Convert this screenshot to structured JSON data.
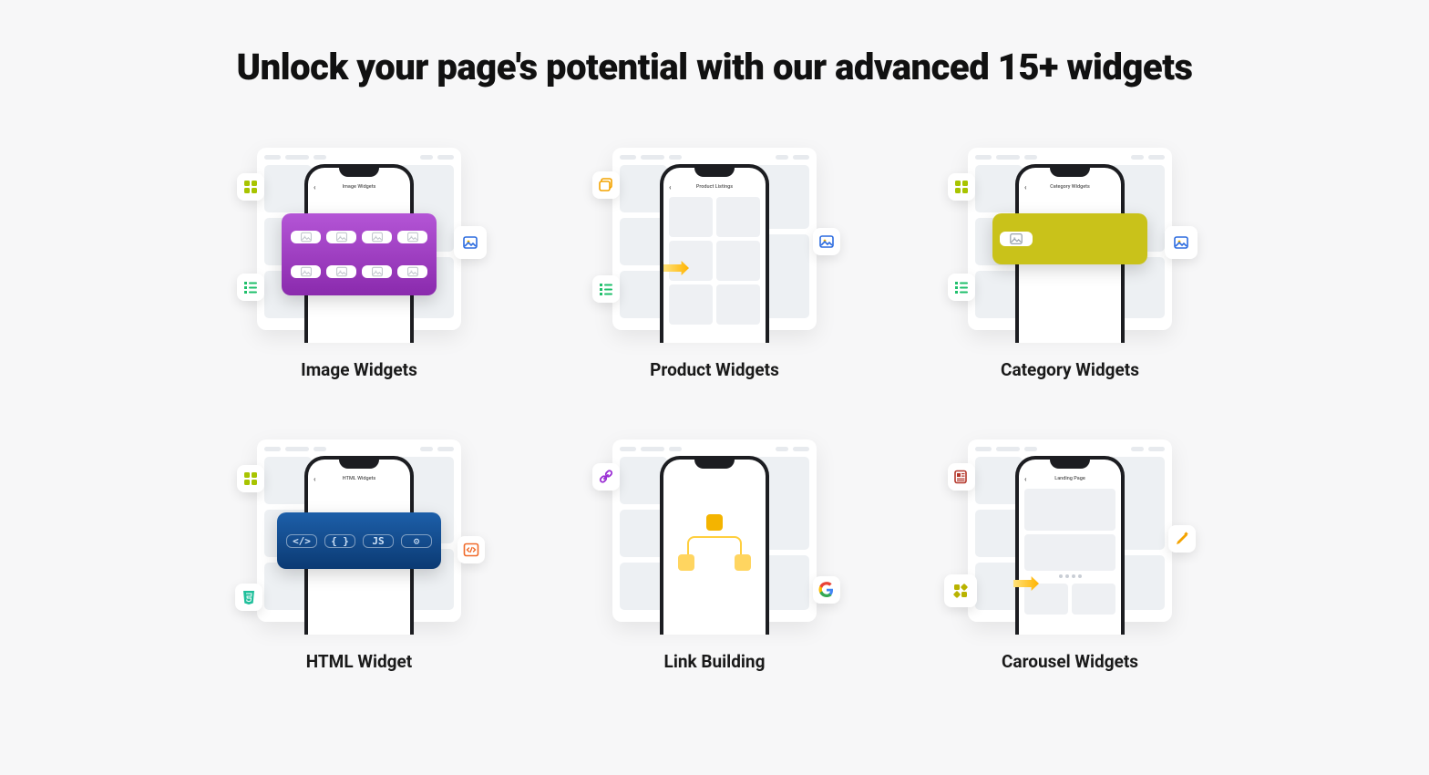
{
  "heading": "Unlock your page's potential with our advanced 15+ widgets",
  "cards": {
    "image": {
      "title": "Image Widgets",
      "phone_label": "Image Widgets"
    },
    "product": {
      "title": "Product Widgets",
      "phone_label": "Product Listings"
    },
    "category": {
      "title": "Category Widgets",
      "phone_label": "Category Widgets"
    },
    "html": {
      "title": "HTML Widget",
      "phone_label": "HTML Widgets"
    },
    "link": {
      "title": "Link Building",
      "phone_label": ""
    },
    "carousel": {
      "title": "Carousel Widgets",
      "phone_label": "Landing Page"
    }
  },
  "html_slots": {
    "s1": "</>",
    "s2": "{ }",
    "s3": "JS",
    "s4": "⚙"
  }
}
